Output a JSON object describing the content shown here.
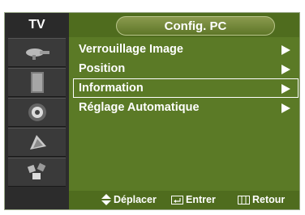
{
  "sidebar": {
    "tv_label": "TV",
    "icons": [
      "satellite-dish-icon",
      "speaker-icon",
      "loudspeaker-icon",
      "wand-icon",
      "connectors-icon"
    ]
  },
  "header": {
    "title": "Config. PC"
  },
  "menu": {
    "items": [
      {
        "label": "Verrouillage Image",
        "selected": false
      },
      {
        "label": "Position",
        "selected": false
      },
      {
        "label": "Information",
        "selected": true
      },
      {
        "label": "Réglage Automatique",
        "selected": false
      }
    ]
  },
  "footer": {
    "move_label": "Déplacer",
    "enter_label": "Entrer",
    "return_label": "Retour"
  },
  "colors": {
    "background": "#5b7a26",
    "sidebar": "#2c2c2c",
    "text": "#ffffff"
  }
}
